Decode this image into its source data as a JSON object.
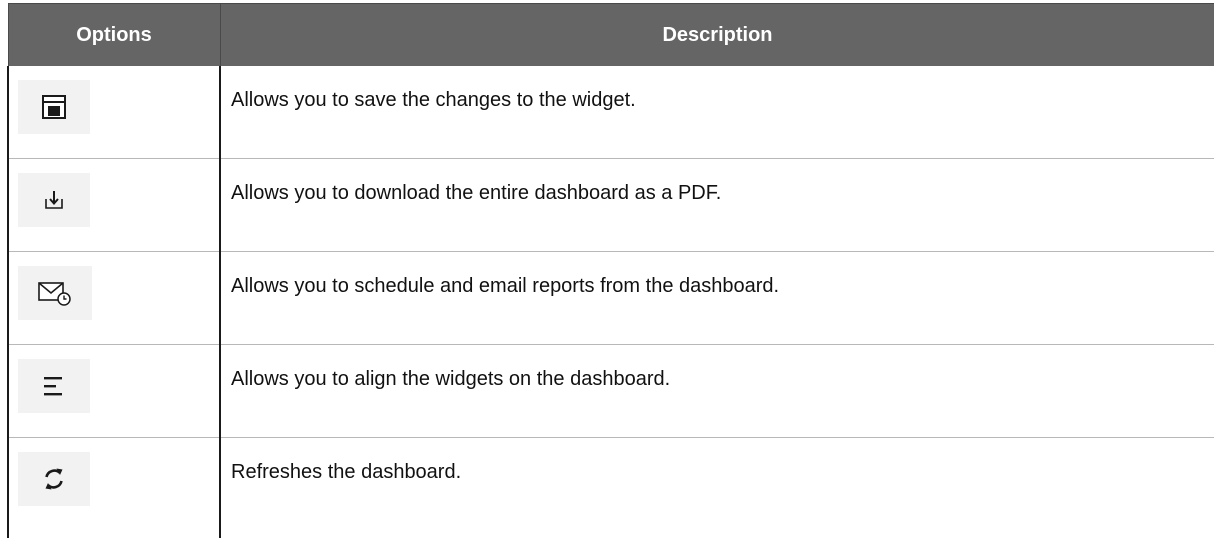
{
  "table": {
    "headers": {
      "options": "Options",
      "description": "Description"
    },
    "rows": [
      {
        "icon": "save-icon",
        "description": "Allows you to save the changes to the widget."
      },
      {
        "icon": "download-icon",
        "description": "Allows you to download the entire dashboard as a PDF."
      },
      {
        "icon": "schedule-email-icon",
        "description": "Allows you to schedule and email reports from the dashboard."
      },
      {
        "icon": "align-icon",
        "description": "Allows you to align the widgets on the dashboard."
      },
      {
        "icon": "refresh-icon",
        "description": "Refreshes the dashboard."
      }
    ]
  },
  "colors": {
    "header_background": "#656565",
    "header_text": "#ffffff",
    "icon_background": "#f2f2f2",
    "icon_stroke": "#1a1a1a"
  }
}
